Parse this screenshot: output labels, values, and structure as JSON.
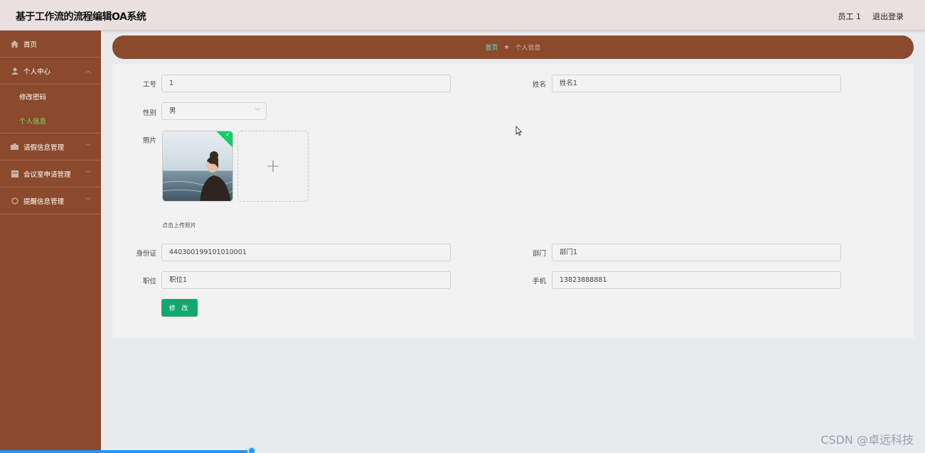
{
  "app": {
    "title": "基于工作流的流程编辑OA系统",
    "user": "员工 1",
    "logout": "退出登录"
  },
  "sidebar": {
    "items": [
      {
        "label": "首页",
        "icon": "home-icon"
      },
      {
        "label": "个人中心",
        "icon": "user-icon",
        "sub": [
          {
            "label": "修改密码"
          },
          {
            "label": "个人信息",
            "active": true
          }
        ]
      },
      {
        "label": "请假信息管理",
        "icon": "briefcase-icon"
      },
      {
        "label": "会议室申请管理",
        "icon": "calendar-icon"
      },
      {
        "label": "提醒信息管理",
        "icon": "circle-icon"
      }
    ]
  },
  "breadcrumb": {
    "home": "首页",
    "separator": "★",
    "current": "个人信息"
  },
  "form": {
    "employee_no": {
      "label": "工号",
      "value": "1"
    },
    "name": {
      "label": "姓名",
      "value": "姓名1"
    },
    "gender": {
      "label": "性别",
      "value": "男"
    },
    "photo": {
      "label": "照片",
      "hint": "点击上传照片"
    },
    "id_card": {
      "label": "身份证",
      "value": "440300199101010001"
    },
    "department": {
      "label": "部门",
      "value": "部门1"
    },
    "position": {
      "label": "职位",
      "value": "职位1"
    },
    "phone": {
      "label": "手机",
      "value": "13823888881"
    },
    "submit": "修 改"
  },
  "watermark": "CSDN @卓远科技",
  "colors": {
    "sidebar": "#8b4a2c",
    "active": "#7ee060",
    "primary": "#13a86e"
  }
}
